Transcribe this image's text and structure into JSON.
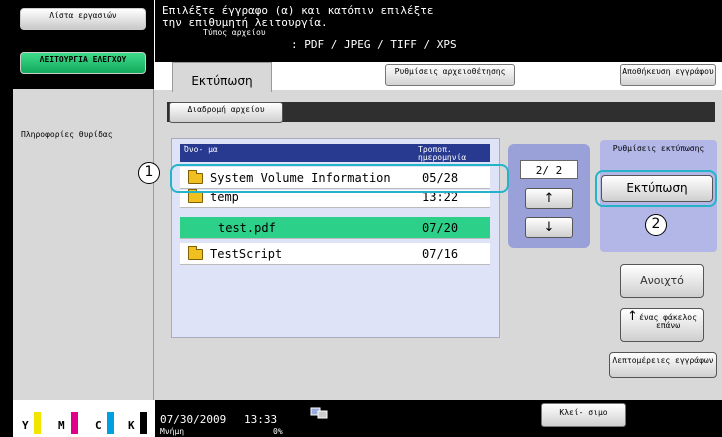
{
  "sidebar": {
    "jobs_label": "Λίστα εργασιών",
    "function_label": "ΛΕΙΤΟΥΡΓΙΑ ΕΛΕΓΧΟΥ",
    "info_label": "Πληροφορίες θυρίδας"
  },
  "toner": {
    "labels": [
      "Y",
      "M",
      "C",
      "K"
    ],
    "colors": [
      "#f2e600",
      "#e0008a",
      "#00a0e0",
      "#000000"
    ]
  },
  "header": {
    "message_line1": "Επιλέξτε έγγραφο (α) και κατόπιν επιλέξτε",
    "message_line2": "την επιθυμητή λειτουργία.",
    "file_type_label": "Τύπος αρχείου",
    "file_type_value": ": PDF / JPEG / TIFF / XPS"
  },
  "tabs": {
    "print": "Εκτύπωση",
    "settings": "Ρυθμίσεις αρχειοθέτησης",
    "save": "Αποθήκευση εγγράφου"
  },
  "main": {
    "path_button": "Διαδρομή αρχείου",
    "list_header_name": "Όνο- μα",
    "list_header_time": "Τροποπ. ημερομηνία",
    "files": [
      {
        "name": "System Volume Information",
        "time": "05/28",
        "type": "folder",
        "selected": false
      },
      {
        "name": "temp",
        "time": "13:22",
        "type": "folder",
        "selected": false
      },
      {
        "name": "test.pdf",
        "time": "07/20",
        "type": "file",
        "selected": true
      },
      {
        "name": "TestScript",
        "time": "07/16",
        "type": "folder",
        "selected": false
      }
    ],
    "page_indicator": "2/ 2",
    "page_up": "↑",
    "page_down": "↓",
    "print_settings_label": "Ρυθμίσεις εκτύπωσης",
    "print_button": "Εκτύπωση",
    "open_button": "Ανοιχτό",
    "up_folder_button": "ένας φάκελος επάνω",
    "up_arrow": "↑",
    "details_button": "Λεπτομέρειες εγγράφων"
  },
  "callouts": {
    "one": "1",
    "two": "2"
  },
  "footer": {
    "date": "07/30/2009",
    "time": "13:33",
    "memory_label": "Μνήμη",
    "memory_value": "0%",
    "close_button": "Κλεί- σιμο"
  },
  "colors": {
    "accent_green": "#2cd089",
    "header_blue": "#283a8f",
    "callout_cyan": "#25b3c9"
  }
}
